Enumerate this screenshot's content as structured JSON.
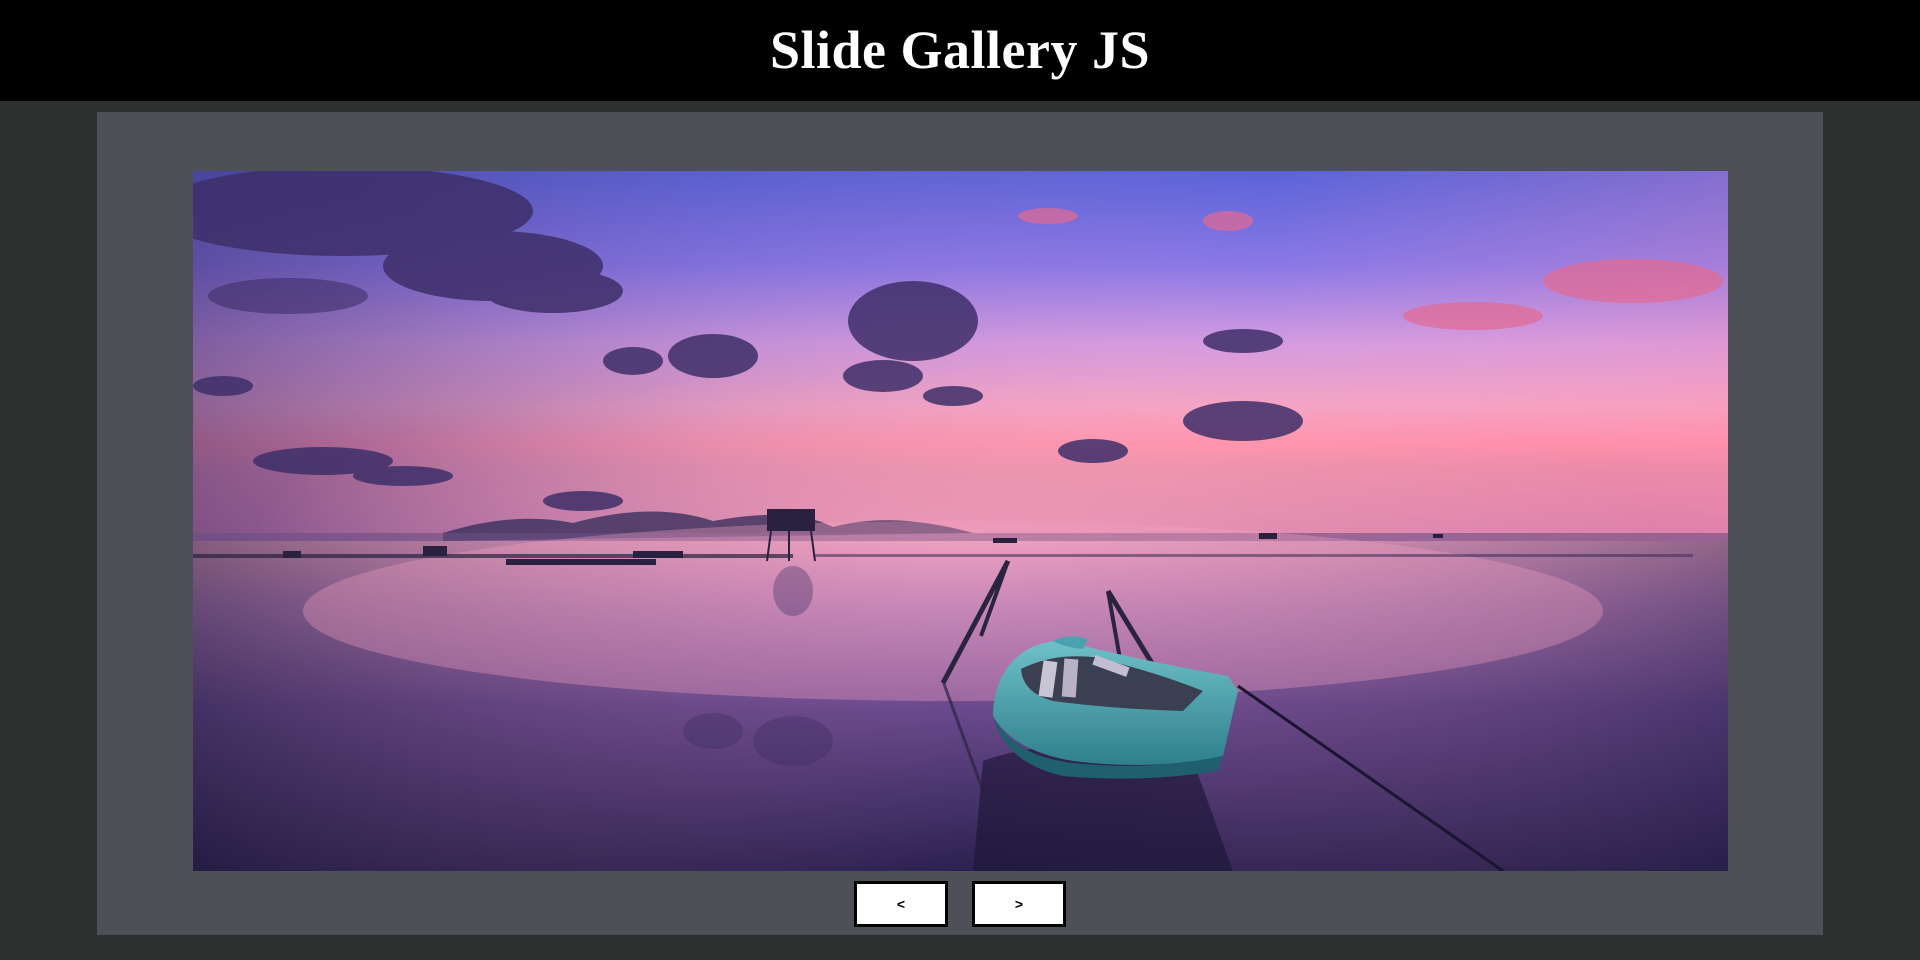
{
  "header": {
    "title": "Slide Gallery JS"
  },
  "gallery": {
    "current_slide": {
      "subject": "sunset-boat-on-lake"
    },
    "controls": {
      "prev_label": "<",
      "next_label": ">"
    }
  },
  "colors": {
    "header_bg": "#000000",
    "page_bg": "#2e2f2f",
    "gallery_bg": "#4d5157",
    "button_bg": "#ffffff",
    "button_border": "#000000"
  }
}
